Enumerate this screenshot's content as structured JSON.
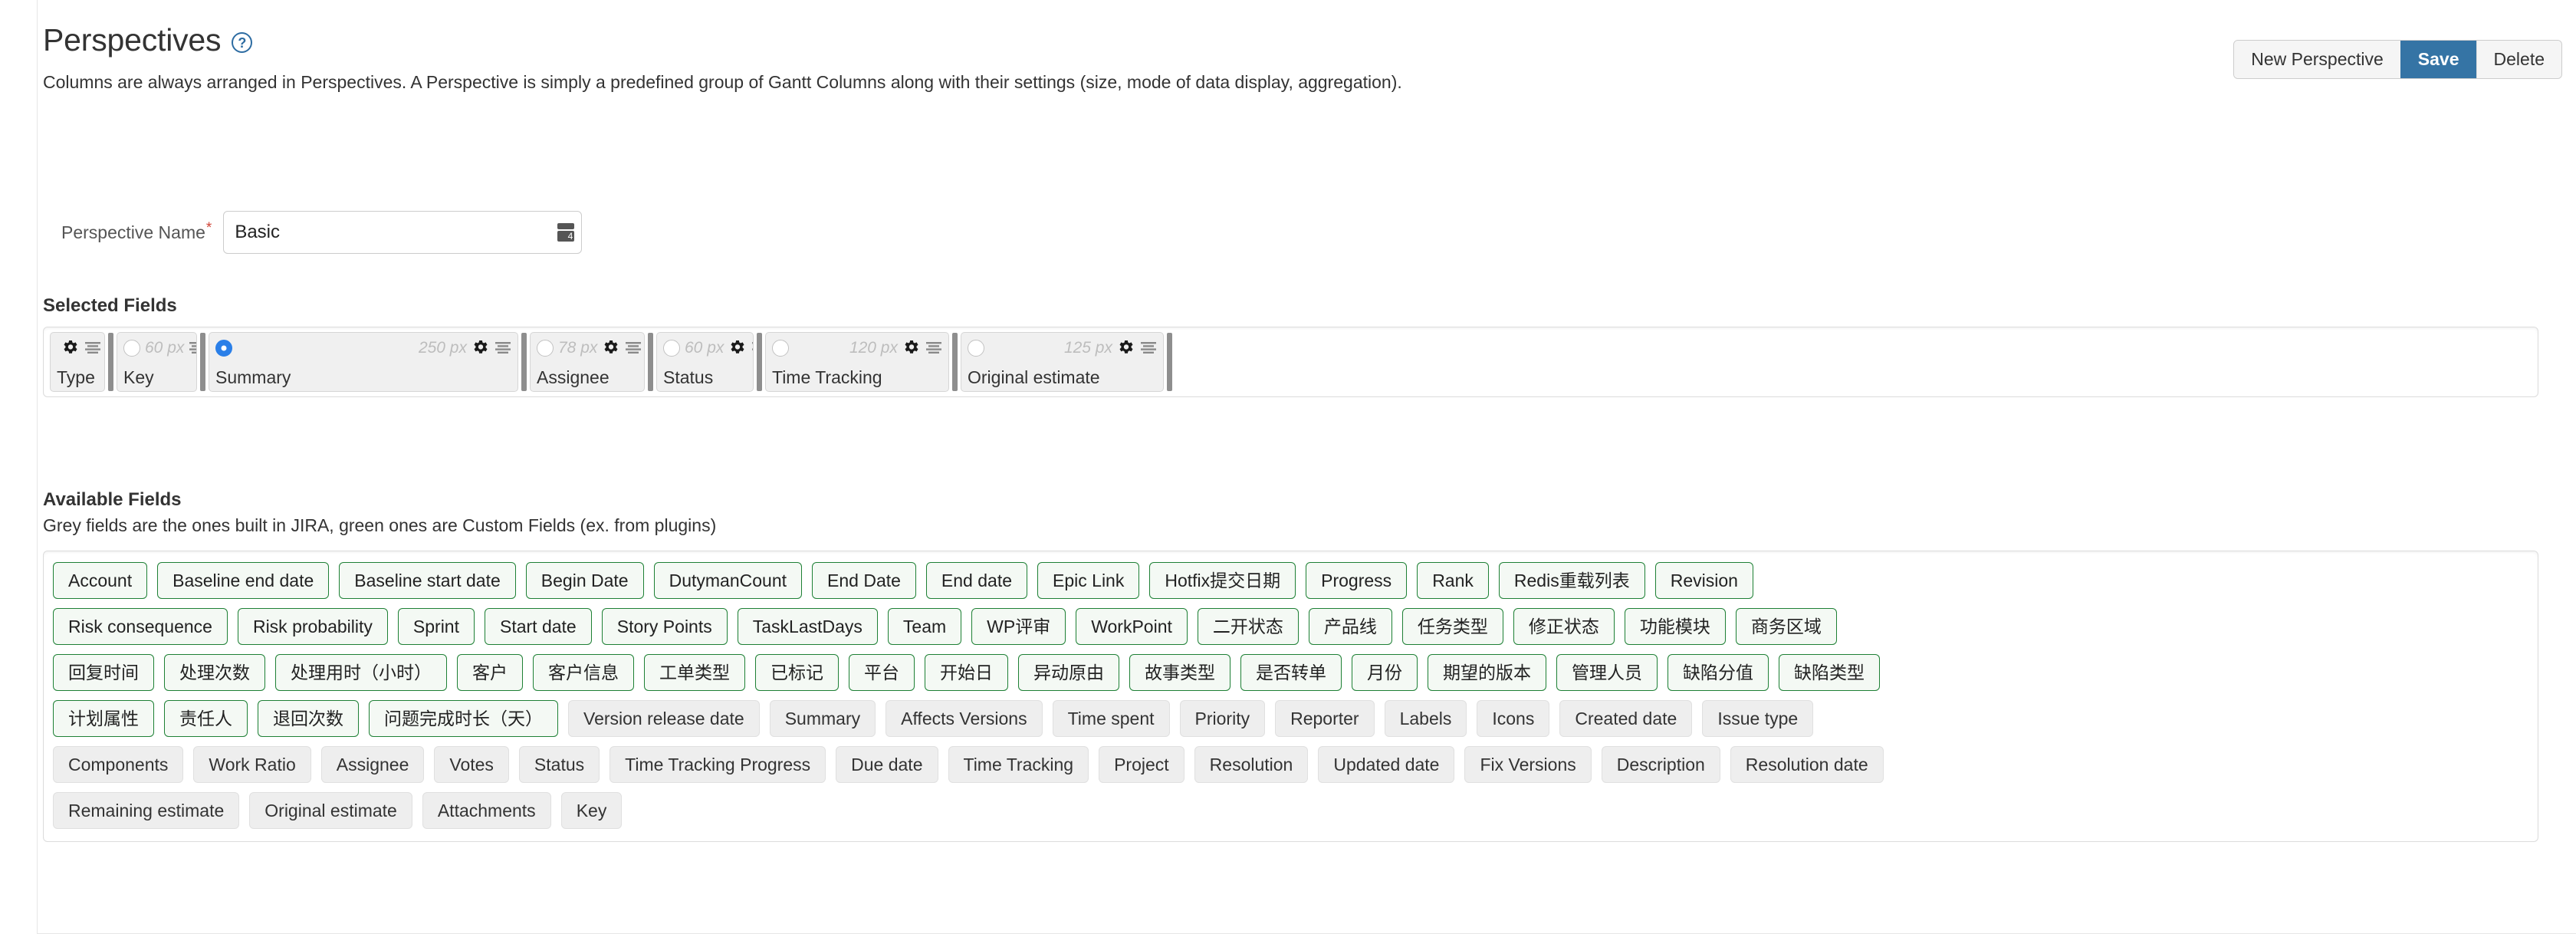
{
  "header": {
    "title": "Perspectives",
    "help_icon": "question-mark-icon",
    "subtitle": "Columns are always arranged in Perspectives. A Perspective is simply a predefined group of Gantt Columns along with their settings (size, mode of data display, aggregation).",
    "actions": [
      {
        "label": "New Perspective",
        "primary": false
      },
      {
        "label": "Save",
        "primary": true
      },
      {
        "label": "Delete",
        "primary": false
      }
    ]
  },
  "perspective_name": {
    "label": "Perspective Name",
    "required_marker": "*",
    "value": "Basic",
    "placeholder": "",
    "gadget_icon": "column-picker-icon"
  },
  "selected_fields": {
    "heading": "Selected Fields",
    "columns": [
      {
        "name": "Type",
        "width": "",
        "radio": "none",
        "gear": true,
        "align": true,
        "chip_width": 72
      },
      {
        "name": "Key",
        "width": "60 px",
        "radio": "unchecked",
        "gear": false,
        "align": true,
        "chip_width": 105
      },
      {
        "name": "Summary",
        "width": "250 px",
        "radio": "checked",
        "gear": true,
        "align": true,
        "chip_width": 404
      },
      {
        "name": "Assignee",
        "width": "78 px",
        "radio": "unchecked",
        "gear": true,
        "align": true,
        "chip_width": 150
      },
      {
        "name": "Status",
        "width": "60 px",
        "radio": "unchecked",
        "gear": true,
        "align": true,
        "chip_width": 127
      },
      {
        "name": "Time Tracking",
        "width": "120 px",
        "radio": "unchecked",
        "gear": true,
        "align": true,
        "chip_width": 240
      },
      {
        "name": "Original estimate",
        "width": "125 px",
        "radio": "unchecked",
        "gear": true,
        "align": true,
        "chip_width": 265
      }
    ]
  },
  "available_fields": {
    "heading": "Available Fields",
    "legend": "Grey fields are the ones built in JIRA, green ones are Custom Fields (ex. from plugins)",
    "colors": {
      "custom_border": "#1e8035",
      "custom_bg": "#f4f9f4",
      "builtin_border": "#e0e0e0",
      "builtin_bg": "#eeeeee"
    },
    "rows": [
      [
        {
          "label": "Account",
          "type": "custom"
        },
        {
          "label": "Baseline end date",
          "type": "custom"
        },
        {
          "label": "Baseline start date",
          "type": "custom"
        },
        {
          "label": "Begin Date",
          "type": "custom"
        },
        {
          "label": "DutymanCount",
          "type": "custom"
        },
        {
          "label": "End Date",
          "type": "custom"
        },
        {
          "label": "End date",
          "type": "custom"
        },
        {
          "label": "Epic Link",
          "type": "custom"
        },
        {
          "label": "Hotfix提交日期",
          "type": "custom"
        },
        {
          "label": "Progress",
          "type": "custom"
        },
        {
          "label": "Rank",
          "type": "custom"
        },
        {
          "label": "Redis重载列表",
          "type": "custom"
        },
        {
          "label": "Revision",
          "type": "custom"
        }
      ],
      [
        {
          "label": "Risk consequence",
          "type": "custom"
        },
        {
          "label": "Risk probability",
          "type": "custom"
        },
        {
          "label": "Sprint",
          "type": "custom"
        },
        {
          "label": "Start date",
          "type": "custom"
        },
        {
          "label": "Story Points",
          "type": "custom"
        },
        {
          "label": "TaskLastDays",
          "type": "custom"
        },
        {
          "label": "Team",
          "type": "custom"
        },
        {
          "label": "WP评审",
          "type": "custom"
        },
        {
          "label": "WorkPoint",
          "type": "custom"
        },
        {
          "label": "二开状态",
          "type": "custom"
        },
        {
          "label": "产品线",
          "type": "custom"
        },
        {
          "label": "任务类型",
          "type": "custom"
        },
        {
          "label": "修正状态",
          "type": "custom"
        },
        {
          "label": "功能模块",
          "type": "custom"
        },
        {
          "label": "商务区域",
          "type": "custom"
        }
      ],
      [
        {
          "label": "回复时间",
          "type": "custom"
        },
        {
          "label": "处理次数",
          "type": "custom"
        },
        {
          "label": "处理用时（小时）",
          "type": "custom"
        },
        {
          "label": "客户",
          "type": "custom"
        },
        {
          "label": "客户信息",
          "type": "custom"
        },
        {
          "label": "工单类型",
          "type": "custom"
        },
        {
          "label": "已标记",
          "type": "custom"
        },
        {
          "label": "平台",
          "type": "custom"
        },
        {
          "label": "开始日",
          "type": "custom"
        },
        {
          "label": "异动原由",
          "type": "custom"
        },
        {
          "label": "故事类型",
          "type": "custom"
        },
        {
          "label": "是否转单",
          "type": "custom"
        },
        {
          "label": "月份",
          "type": "custom"
        },
        {
          "label": "期望的版本",
          "type": "custom"
        },
        {
          "label": "管理人员",
          "type": "custom"
        },
        {
          "label": "缺陷分值",
          "type": "custom"
        },
        {
          "label": "缺陷类型",
          "type": "custom"
        }
      ],
      [
        {
          "label": "计划属性",
          "type": "custom"
        },
        {
          "label": "责任人",
          "type": "custom"
        },
        {
          "label": "退回次数",
          "type": "custom"
        },
        {
          "label": "问题完成时长（天）",
          "type": "custom"
        },
        {
          "label": "Version release date",
          "type": "builtin"
        },
        {
          "label": "Summary",
          "type": "builtin"
        },
        {
          "label": "Affects Versions",
          "type": "builtin"
        },
        {
          "label": "Time spent",
          "type": "builtin"
        },
        {
          "label": "Priority",
          "type": "builtin"
        },
        {
          "label": "Reporter",
          "type": "builtin"
        },
        {
          "label": "Labels",
          "type": "builtin"
        },
        {
          "label": "Icons",
          "type": "builtin"
        },
        {
          "label": "Created date",
          "type": "builtin"
        },
        {
          "label": "Issue type",
          "type": "builtin"
        }
      ],
      [
        {
          "label": "Components",
          "type": "builtin"
        },
        {
          "label": "Work Ratio",
          "type": "builtin"
        },
        {
          "label": "Assignee",
          "type": "builtin"
        },
        {
          "label": "Votes",
          "type": "builtin"
        },
        {
          "label": "Status",
          "type": "builtin"
        },
        {
          "label": "Time Tracking Progress",
          "type": "builtin"
        },
        {
          "label": "Due date",
          "type": "builtin"
        },
        {
          "label": "Time Tracking",
          "type": "builtin"
        },
        {
          "label": "Project",
          "type": "builtin"
        },
        {
          "label": "Resolution",
          "type": "builtin"
        },
        {
          "label": "Updated date",
          "type": "builtin"
        },
        {
          "label": "Fix Versions",
          "type": "builtin"
        },
        {
          "label": "Description",
          "type": "builtin"
        },
        {
          "label": "Resolution date",
          "type": "builtin"
        }
      ],
      [
        {
          "label": "Remaining estimate",
          "type": "builtin"
        },
        {
          "label": "Original estimate",
          "type": "builtin"
        },
        {
          "label": "Attachments",
          "type": "builtin"
        },
        {
          "label": "Key",
          "type": "builtin"
        }
      ]
    ]
  }
}
